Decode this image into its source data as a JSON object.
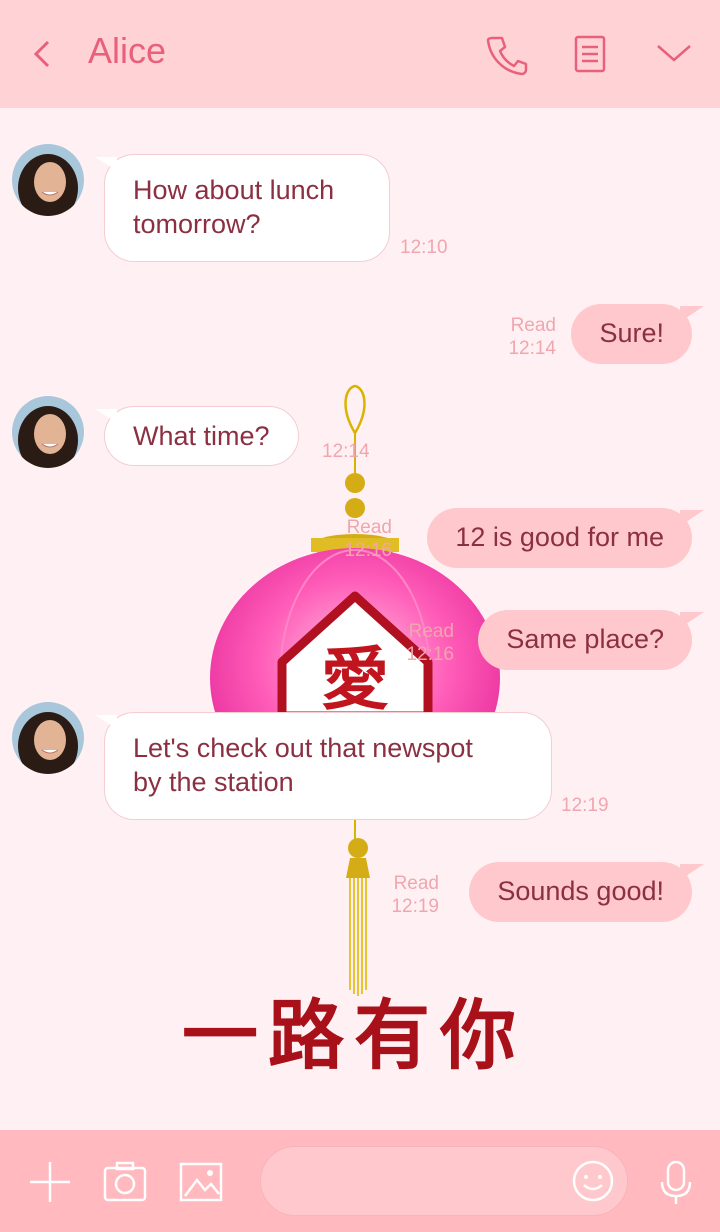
{
  "header": {
    "title": "Alice",
    "icons": [
      "back-icon",
      "phone-icon",
      "notes-icon",
      "chevron-down-icon"
    ]
  },
  "messages": [
    {
      "direction": "in",
      "text_lines": [
        "How about lunch",
        "tomorrow?"
      ],
      "time": "12:10"
    },
    {
      "direction": "out",
      "text": "Sure!",
      "read": "Read",
      "time": "12:14"
    },
    {
      "direction": "in",
      "text": "What time?",
      "time": "12:14"
    },
    {
      "direction": "out",
      "text": "12 is good for me",
      "read": "Read",
      "time": "12:16"
    },
    {
      "direction": "out",
      "text": "Same place?",
      "read": "Read",
      "time": "12:16"
    },
    {
      "direction": "in",
      "text_lines": [
        "Let's check out that newspot",
        "by the station"
      ],
      "time": "12:19"
    },
    {
      "direction": "out",
      "text": "Sounds good!",
      "read": "Read",
      "time": "12:19"
    }
  ],
  "background_art": {
    "lantern_character": "愛",
    "slogan": "一路有你"
  },
  "bottom_bar": {
    "icons": [
      "plus-icon",
      "camera-icon",
      "image-icon",
      "emoji-icon",
      "microphone-icon"
    ],
    "input_placeholder": ""
  },
  "colors": {
    "header_bg": "#ffd2d6",
    "accent": "#e8607a",
    "chat_bg": "#fff1f3",
    "incoming_bubble": "#ffffff",
    "outgoing_bubble": "#ffc8cc",
    "timestamp": "#f0a6ae",
    "text": "#8b3042",
    "bottom_bar_bg": "#ffb9bf"
  }
}
